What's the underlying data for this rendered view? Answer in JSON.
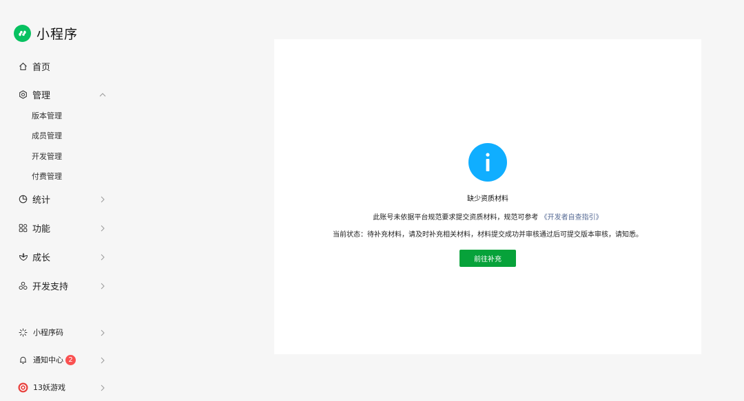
{
  "brand": {
    "title": "小程序",
    "logo_icon": "mini-program-logo-icon",
    "color": "#07c160"
  },
  "nav": {
    "home": {
      "label": "首页",
      "icon": "home-icon"
    },
    "manage": {
      "label": "管理",
      "icon": "settings-icon",
      "expanded": true,
      "children": [
        "版本管理",
        "成员管理",
        "开发管理",
        "付费管理"
      ]
    },
    "stats": {
      "label": "统计",
      "icon": "pie-chart-icon"
    },
    "features": {
      "label": "功能",
      "icon": "grid-icon"
    },
    "growth": {
      "label": "成长",
      "icon": "growth-icon"
    },
    "dev_support": {
      "label": "开发支持",
      "icon": "support-icon"
    }
  },
  "bottom_nav": {
    "qrcode": {
      "label": "小程序码",
      "icon": "qrcode-icon"
    },
    "notifications": {
      "label": "通知中心",
      "icon": "bell-icon",
      "badge": "2"
    },
    "account": {
      "label": "13妖游戏",
      "icon": "account-avatar-icon"
    }
  },
  "notice": {
    "icon": "info-icon",
    "icon_color": "#10aeff",
    "title": "缺少资质材料",
    "description_prefix": "此账号未依据平台规范要求提交资质材料，规范可参考",
    "description_link": "《开发者自查指引》",
    "status": "当前状态：待补充材料，请及时补充相关材料，材料提交成功并审核通过后可提交版本审核，请知悉。",
    "button_label": "前往补充",
    "button_color": "#07a23a"
  }
}
